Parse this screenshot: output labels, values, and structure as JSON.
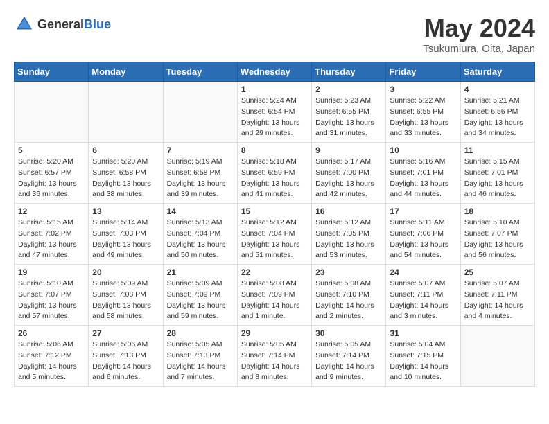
{
  "header": {
    "logo_general": "General",
    "logo_blue": "Blue",
    "title": "May 2024",
    "subtitle": "Tsukumiura, Oita, Japan"
  },
  "weekdays": [
    "Sunday",
    "Monday",
    "Tuesday",
    "Wednesday",
    "Thursday",
    "Friday",
    "Saturday"
  ],
  "weeks": [
    [
      {
        "day": "",
        "sunrise": "",
        "sunset": "",
        "daylight": "",
        "empty": true
      },
      {
        "day": "",
        "sunrise": "",
        "sunset": "",
        "daylight": "",
        "empty": true
      },
      {
        "day": "",
        "sunrise": "",
        "sunset": "",
        "daylight": "",
        "empty": true
      },
      {
        "day": "1",
        "sunrise": "Sunrise: 5:24 AM",
        "sunset": "Sunset: 6:54 PM",
        "daylight": "Daylight: 13 hours and 29 minutes."
      },
      {
        "day": "2",
        "sunrise": "Sunrise: 5:23 AM",
        "sunset": "Sunset: 6:55 PM",
        "daylight": "Daylight: 13 hours and 31 minutes."
      },
      {
        "day": "3",
        "sunrise": "Sunrise: 5:22 AM",
        "sunset": "Sunset: 6:55 PM",
        "daylight": "Daylight: 13 hours and 33 minutes."
      },
      {
        "day": "4",
        "sunrise": "Sunrise: 5:21 AM",
        "sunset": "Sunset: 6:56 PM",
        "daylight": "Daylight: 13 hours and 34 minutes."
      }
    ],
    [
      {
        "day": "5",
        "sunrise": "Sunrise: 5:20 AM",
        "sunset": "Sunset: 6:57 PM",
        "daylight": "Daylight: 13 hours and 36 minutes."
      },
      {
        "day": "6",
        "sunrise": "Sunrise: 5:20 AM",
        "sunset": "Sunset: 6:58 PM",
        "daylight": "Daylight: 13 hours and 38 minutes."
      },
      {
        "day": "7",
        "sunrise": "Sunrise: 5:19 AM",
        "sunset": "Sunset: 6:58 PM",
        "daylight": "Daylight: 13 hours and 39 minutes."
      },
      {
        "day": "8",
        "sunrise": "Sunrise: 5:18 AM",
        "sunset": "Sunset: 6:59 PM",
        "daylight": "Daylight: 13 hours and 41 minutes."
      },
      {
        "day": "9",
        "sunrise": "Sunrise: 5:17 AM",
        "sunset": "Sunset: 7:00 PM",
        "daylight": "Daylight: 13 hours and 42 minutes."
      },
      {
        "day": "10",
        "sunrise": "Sunrise: 5:16 AM",
        "sunset": "Sunset: 7:01 PM",
        "daylight": "Daylight: 13 hours and 44 minutes."
      },
      {
        "day": "11",
        "sunrise": "Sunrise: 5:15 AM",
        "sunset": "Sunset: 7:01 PM",
        "daylight": "Daylight: 13 hours and 46 minutes."
      }
    ],
    [
      {
        "day": "12",
        "sunrise": "Sunrise: 5:15 AM",
        "sunset": "Sunset: 7:02 PM",
        "daylight": "Daylight: 13 hours and 47 minutes."
      },
      {
        "day": "13",
        "sunrise": "Sunrise: 5:14 AM",
        "sunset": "Sunset: 7:03 PM",
        "daylight": "Daylight: 13 hours and 49 minutes."
      },
      {
        "day": "14",
        "sunrise": "Sunrise: 5:13 AM",
        "sunset": "Sunset: 7:04 PM",
        "daylight": "Daylight: 13 hours and 50 minutes."
      },
      {
        "day": "15",
        "sunrise": "Sunrise: 5:12 AM",
        "sunset": "Sunset: 7:04 PM",
        "daylight": "Daylight: 13 hours and 51 minutes."
      },
      {
        "day": "16",
        "sunrise": "Sunrise: 5:12 AM",
        "sunset": "Sunset: 7:05 PM",
        "daylight": "Daylight: 13 hours and 53 minutes."
      },
      {
        "day": "17",
        "sunrise": "Sunrise: 5:11 AM",
        "sunset": "Sunset: 7:06 PM",
        "daylight": "Daylight: 13 hours and 54 minutes."
      },
      {
        "day": "18",
        "sunrise": "Sunrise: 5:10 AM",
        "sunset": "Sunset: 7:07 PM",
        "daylight": "Daylight: 13 hours and 56 minutes."
      }
    ],
    [
      {
        "day": "19",
        "sunrise": "Sunrise: 5:10 AM",
        "sunset": "Sunset: 7:07 PM",
        "daylight": "Daylight: 13 hours and 57 minutes."
      },
      {
        "day": "20",
        "sunrise": "Sunrise: 5:09 AM",
        "sunset": "Sunset: 7:08 PM",
        "daylight": "Daylight: 13 hours and 58 minutes."
      },
      {
        "day": "21",
        "sunrise": "Sunrise: 5:09 AM",
        "sunset": "Sunset: 7:09 PM",
        "daylight": "Daylight: 13 hours and 59 minutes."
      },
      {
        "day": "22",
        "sunrise": "Sunrise: 5:08 AM",
        "sunset": "Sunset: 7:09 PM",
        "daylight": "Daylight: 14 hours and 1 minute."
      },
      {
        "day": "23",
        "sunrise": "Sunrise: 5:08 AM",
        "sunset": "Sunset: 7:10 PM",
        "daylight": "Daylight: 14 hours and 2 minutes."
      },
      {
        "day": "24",
        "sunrise": "Sunrise: 5:07 AM",
        "sunset": "Sunset: 7:11 PM",
        "daylight": "Daylight: 14 hours and 3 minutes."
      },
      {
        "day": "25",
        "sunrise": "Sunrise: 5:07 AM",
        "sunset": "Sunset: 7:11 PM",
        "daylight": "Daylight: 14 hours and 4 minutes."
      }
    ],
    [
      {
        "day": "26",
        "sunrise": "Sunrise: 5:06 AM",
        "sunset": "Sunset: 7:12 PM",
        "daylight": "Daylight: 14 hours and 5 minutes."
      },
      {
        "day": "27",
        "sunrise": "Sunrise: 5:06 AM",
        "sunset": "Sunset: 7:13 PM",
        "daylight": "Daylight: 14 hours and 6 minutes."
      },
      {
        "day": "28",
        "sunrise": "Sunrise: 5:05 AM",
        "sunset": "Sunset: 7:13 PM",
        "daylight": "Daylight: 14 hours and 7 minutes."
      },
      {
        "day": "29",
        "sunrise": "Sunrise: 5:05 AM",
        "sunset": "Sunset: 7:14 PM",
        "daylight": "Daylight: 14 hours and 8 minutes."
      },
      {
        "day": "30",
        "sunrise": "Sunrise: 5:05 AM",
        "sunset": "Sunset: 7:14 PM",
        "daylight": "Daylight: 14 hours and 9 minutes."
      },
      {
        "day": "31",
        "sunrise": "Sunrise: 5:04 AM",
        "sunset": "Sunset: 7:15 PM",
        "daylight": "Daylight: 14 hours and 10 minutes."
      },
      {
        "day": "",
        "sunrise": "",
        "sunset": "",
        "daylight": "",
        "empty": true
      }
    ]
  ]
}
